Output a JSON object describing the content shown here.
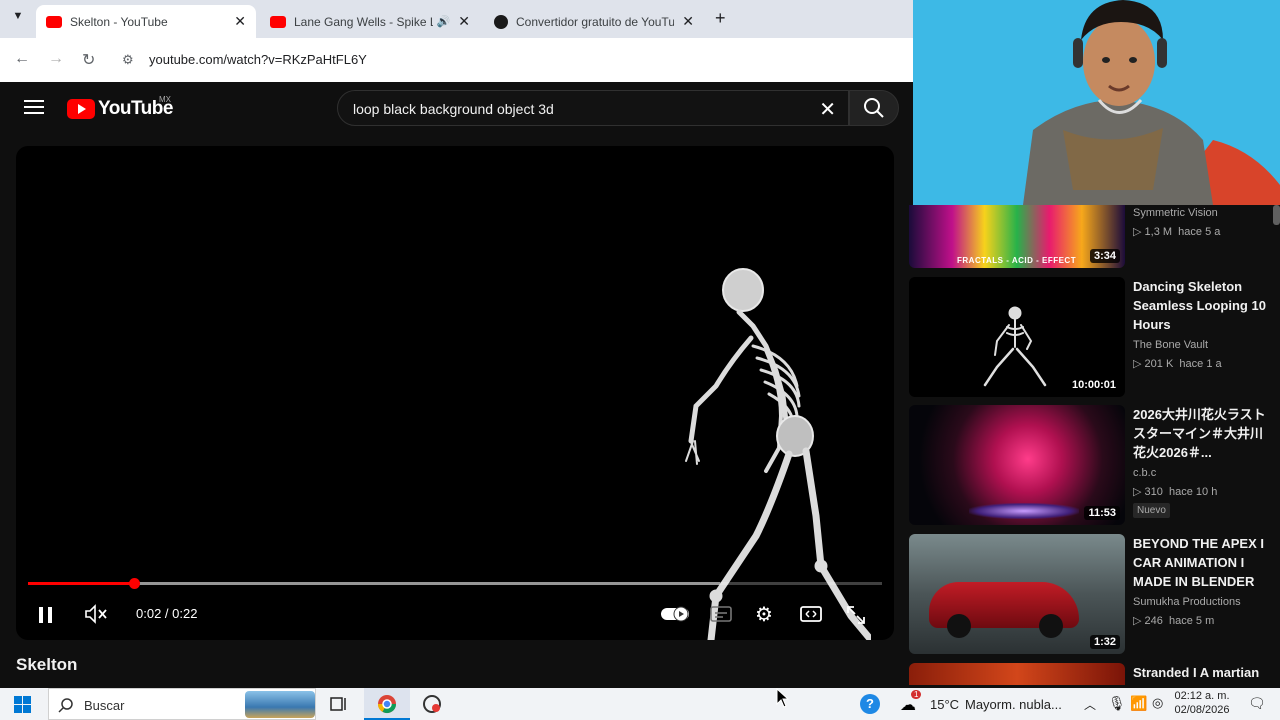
{
  "browser": {
    "tabs": [
      {
        "title": "Skelton - YouTube",
        "active": true
      },
      {
        "title": "Lane Gang Wells - Spike Le",
        "audio": true
      },
      {
        "title": "Convertidor gratuito de YouTub"
      }
    ],
    "url": "youtube.com/watch?v=RKzPaHtFL6Y"
  },
  "youtube": {
    "logo_text": "YouTube",
    "region": "MX",
    "search_query": "loop black background object 3d"
  },
  "player": {
    "time_display": "0:02 / 0:22",
    "progress_fraction": 0.124,
    "buffered_fraction": 0.81,
    "video_title": "Skelton"
  },
  "recommendations": [
    {
      "title": "",
      "channel": "Symmetric Vision",
      "views": "1,3 M",
      "age": "hace 5 a",
      "duration": "3:34",
      "thumb_text": "FRACTALS - ACID - EFFECT"
    },
    {
      "title": "Dancing Skeleton Seamless Looping 10 Hours",
      "channel": "The Bone Vault",
      "views": "201 K",
      "age": "hace 1 a",
      "duration": "10:00:01"
    },
    {
      "title": "2026大井川花火ラストスターマイン＃大井川花火2026＃...",
      "channel": "c.b.c",
      "views": "310",
      "age": "hace 10 h",
      "duration": "11:53",
      "badge": "Nuevo"
    },
    {
      "title": "BEYOND THE APEX I CAR ANIMATION I MADE IN BLENDER",
      "channel": "Sumukha Productions",
      "views": "246",
      "age": "hace 5 m",
      "duration": "1:32"
    },
    {
      "title": "Stranded I A martian",
      "channel": "",
      "views": "",
      "age": "",
      "duration": ""
    }
  ],
  "taskbar": {
    "search_label": "Buscar",
    "weather_temp": "15°C",
    "weather_desc": "Mayorm. nubla...",
    "weather_badge": "1",
    "time": "02:12 a. m.",
    "date": "02/08/2026"
  },
  "colors": {
    "youtube_red": "#ff0000",
    "background": "#0f0f0f",
    "webcam_wall": "#3db9e6",
    "chrome_tabbar": "#dfe3eb"
  }
}
